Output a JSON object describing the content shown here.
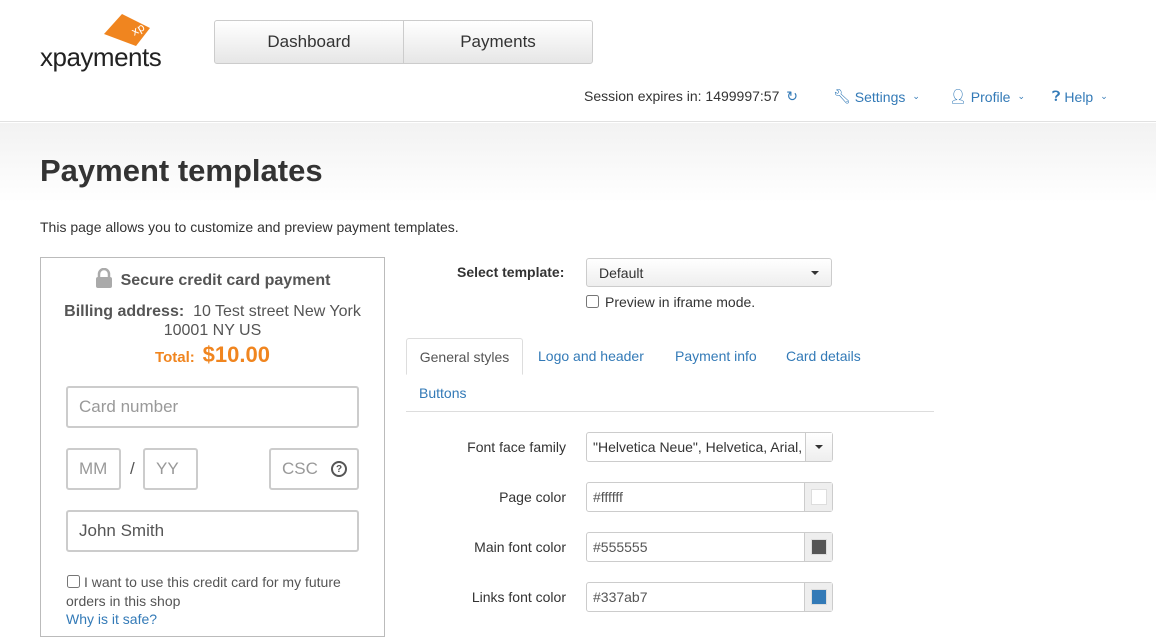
{
  "header": {
    "logo_text": "xpayments",
    "logo_tag": "xp",
    "nav": [
      "Dashboard",
      "Payments"
    ],
    "session_label": "Session expires in:",
    "session_value": "1499997:57",
    "menus": {
      "settings": "Settings",
      "profile": "Profile",
      "help": "Help"
    }
  },
  "page": {
    "title": "Payment templates",
    "description": "This page allows you to customize and preview payment templates."
  },
  "preview": {
    "secure_title": "Secure credit card payment",
    "billing_label": "Billing address:",
    "billing_line1": "10 Test street New York",
    "billing_line2": "10001 NY US",
    "total_label": "Total:",
    "total_value": "$10.00",
    "card_number_placeholder": "Card number",
    "mm_placeholder": "MM",
    "slash": "/",
    "yy_placeholder": "YY",
    "csc_placeholder": "CSC",
    "cardholder": "John Smith",
    "save_card_label": "I want to use this credit card for my future orders in this shop",
    "why_safe": "Why is it safe?"
  },
  "settings": {
    "select_label": "Select template:",
    "selected_template": "Default",
    "iframe_label": "Preview in iframe mode.",
    "tabs": [
      "General styles",
      "Logo and header",
      "Payment info",
      "Card details",
      "Buttons"
    ],
    "rows": [
      {
        "label": "Font face family",
        "value": "\"Helvetica Neue\", Helvetica, Arial, sans-serif"
      },
      {
        "label": "Page color",
        "value": "#ffffff",
        "swatch": "#ffffff"
      },
      {
        "label": "Main font color",
        "value": "#555555",
        "swatch": "#555555"
      },
      {
        "label": "Links font color",
        "value": "#337ab7",
        "swatch": "#337ab7"
      }
    ]
  },
  "colors": {
    "accent": "#337ab7",
    "brand_orange": "#f0851f"
  }
}
